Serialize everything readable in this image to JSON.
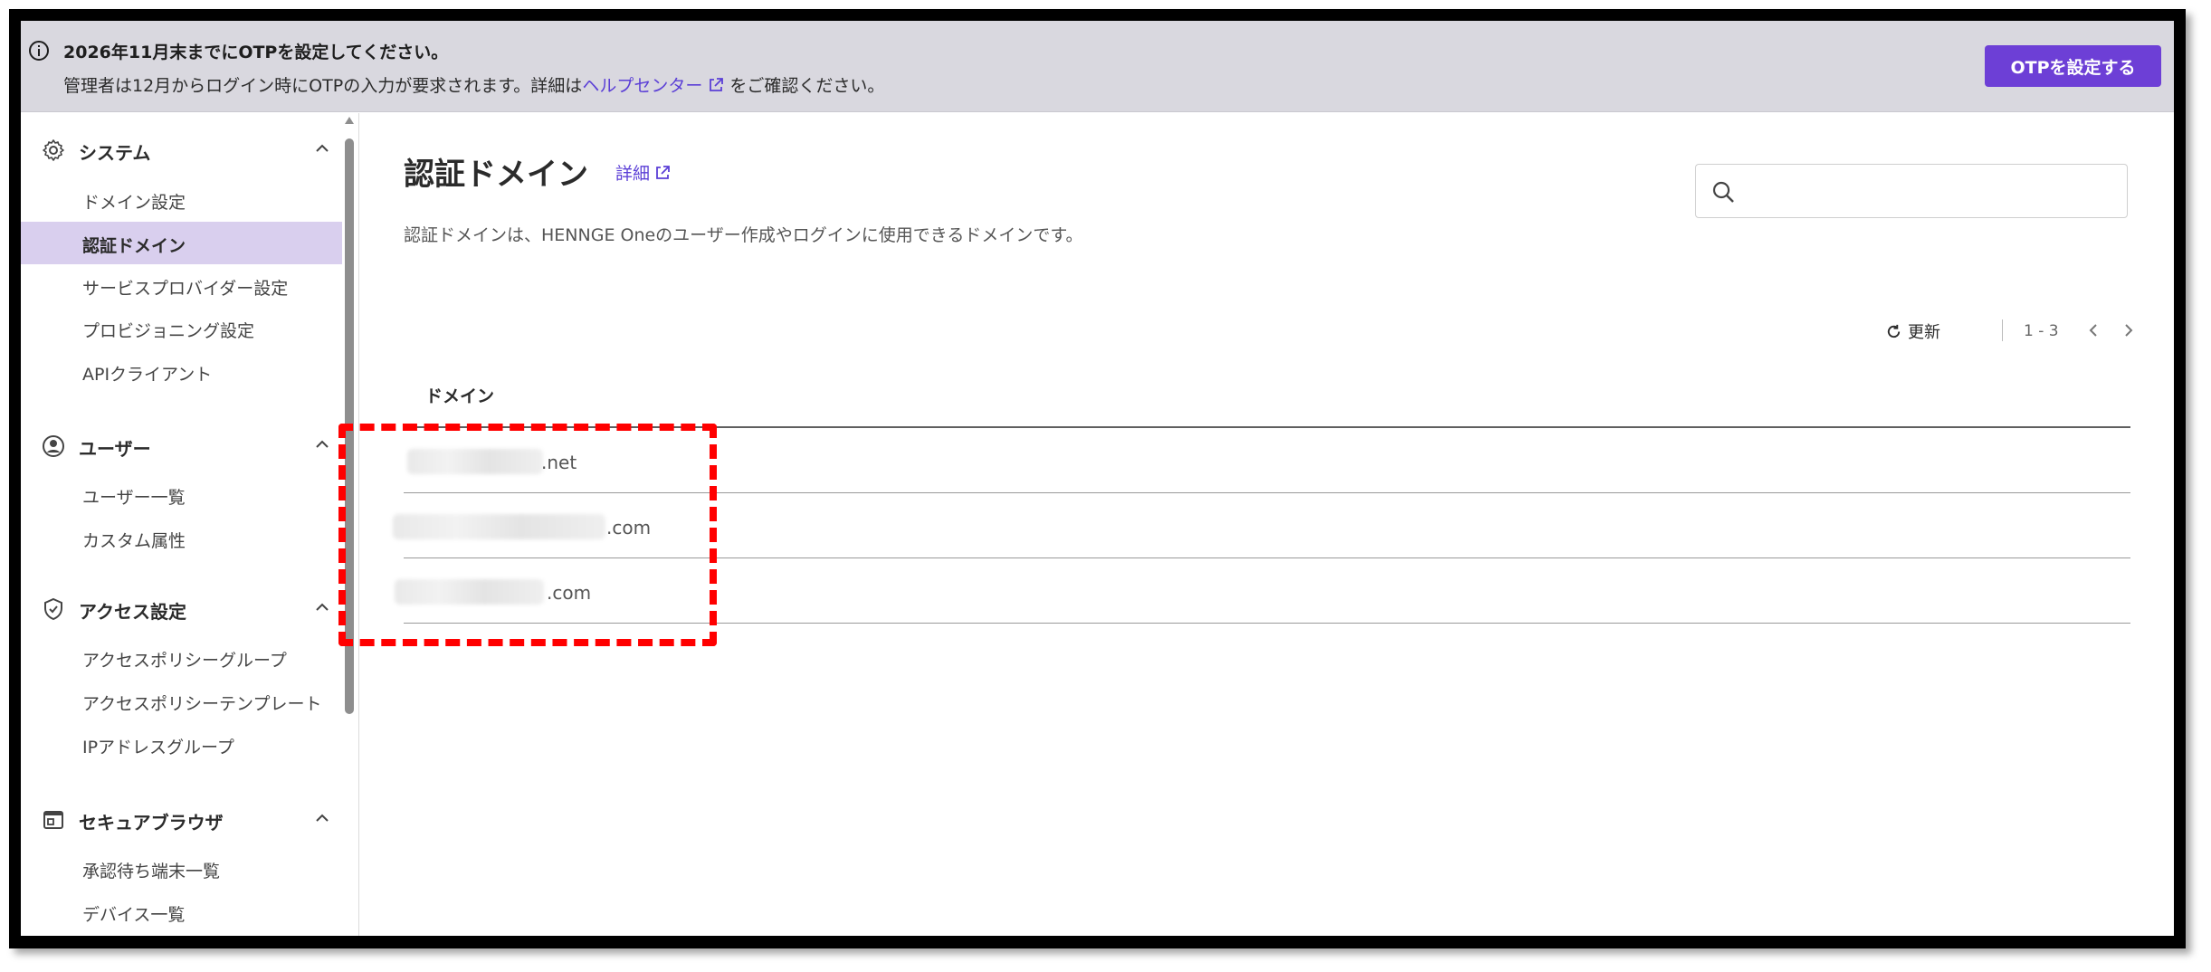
{
  "banner": {
    "title": "2026年11月末までにOTPを設定してください。",
    "desc_prefix": "管理者は12月からログイン時にOTPの入力が要求されます。詳細は",
    "help_link": "ヘルプセンター",
    "desc_suffix": "をご確認ください。",
    "button": "OTPを設定する",
    "accent_color": "#6d3fd6"
  },
  "sidebar": {
    "sections": [
      {
        "icon": "gear-icon",
        "label": "システム",
        "items": [
          "ドメイン設定",
          "認証ドメイン",
          "サービスプロバイダー設定",
          "プロビジョニング設定",
          "APIクライアント"
        ]
      },
      {
        "icon": "user-circle-icon",
        "label": "ユーザー",
        "items": [
          "ユーザー一覧",
          "カスタム属性"
        ]
      },
      {
        "icon": "shield-check-icon",
        "label": "アクセス設定",
        "items": [
          "アクセスポリシーグループ",
          "アクセスポリシーテンプレート",
          "IPアドレスグループ"
        ]
      },
      {
        "icon": "browser-window-icon",
        "label": "セキュアブラウザ",
        "items": [
          "承認待ち端末一覧",
          "デバイス一覧"
        ]
      }
    ],
    "active_item": "認証ドメイン"
  },
  "main": {
    "title": "認証ドメイン",
    "detail_link": "詳細",
    "description": "認証ドメインは、HENNGE Oneのユーザー作成やログインに使用できるドメインです。",
    "search_placeholder": "",
    "refresh": "更新",
    "pager_range": "1 - 3",
    "column_header": "ドメイン",
    "rows": [
      {
        "suffix": ".net"
      },
      {
        "suffix": ".com"
      },
      {
        "suffix": ".com"
      }
    ]
  }
}
